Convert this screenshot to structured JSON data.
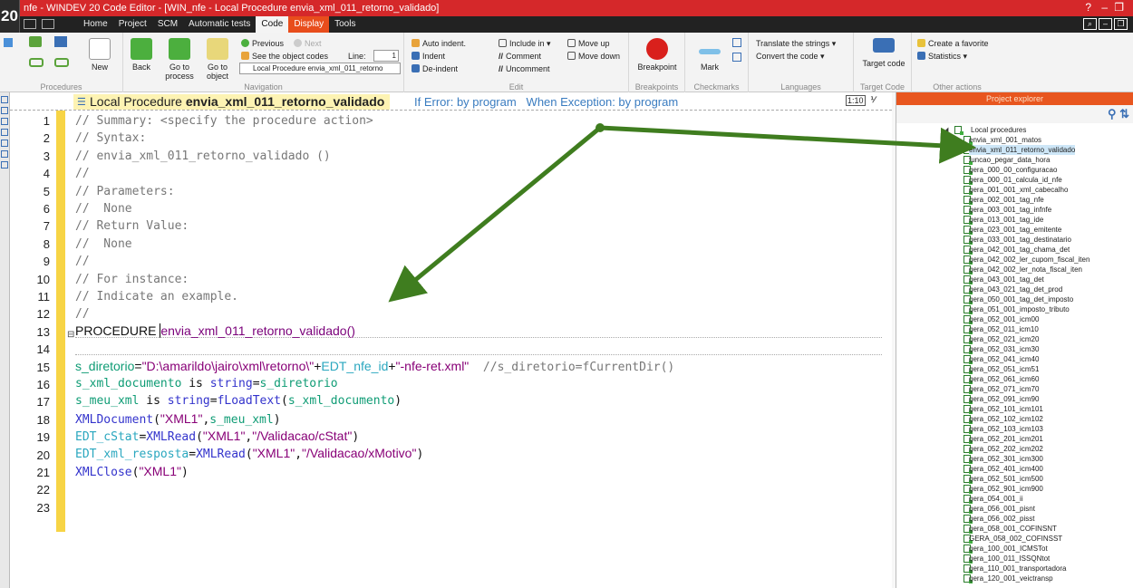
{
  "window": {
    "logo": "20",
    "title": "nfe - WINDEV 20  Code Editor - [WIN_nfe - Local Procedure envia_xml_011_retorno_validado]"
  },
  "menu": {
    "tabs": [
      "Home",
      "Project",
      "SCM",
      "Automatic tests",
      "Code",
      "Display",
      "Tools"
    ]
  },
  "ribbon": {
    "procedures": {
      "label": "Procedures",
      "new": "New"
    },
    "navigation": {
      "label": "Navigation",
      "back": "Back",
      "goto_process": "Go to process",
      "goto_object": "Go to object",
      "previous": "Previous",
      "next": "Next",
      "see_codes": "See the object codes",
      "line_label": "Line:",
      "line_value": "1",
      "combo_value": "Local Procedure envia_xml_011_retorno"
    },
    "edit": {
      "label": "Edit",
      "auto_indent": "Auto indent.",
      "indent": "Indent",
      "deindent": "De-indent",
      "include_in": "Include in",
      "comment": "Comment",
      "uncomment": "Uncomment",
      "move_up": "Move up",
      "move_down": "Move down"
    },
    "breakpoints": {
      "label": "Breakpoints",
      "breakpoint": "Breakpoint"
    },
    "checkmarks": {
      "label": "Checkmarks",
      "mark": "Mark"
    },
    "languages": {
      "label": "Languages",
      "translate": "Translate the strings",
      "convert": "Convert the code"
    },
    "target": {
      "label": "Target Code",
      "target_code": "Target code"
    },
    "other": {
      "label": "Other actions",
      "favorite": "Create a favorite",
      "statistics": "Statistics"
    }
  },
  "editor": {
    "proc_prefix": "Local Procedure ",
    "proc_name": "envia_xml_011_retorno_validado",
    "if_error": "If Error: by program",
    "when_exception": "When Exception: by program",
    "line_numbers": [
      "1",
      "2",
      "3",
      "4",
      "5",
      "6",
      "7",
      "8",
      "9",
      "10",
      "11",
      "12",
      "13",
      "14",
      "15",
      "16",
      "17",
      "18",
      "19",
      "20",
      "21",
      "22",
      "23"
    ],
    "comments": [
      "// Summary: <specify the procedure action>",
      "// Syntax:",
      "// envia_xml_011_retorno_validado ()",
      "//",
      "// Parameters:",
      "//  None",
      "// Return Value:",
      "//  None",
      "//",
      "// For instance:",
      "// Indicate an example.",
      "//"
    ],
    "l13": {
      "kw": "PROCEDURE ",
      "name": "envia_xml_011_retorno_validado()"
    },
    "l15": {
      "var": "s_diretorio",
      "eq": "=",
      "str1": "\"D:\\amarildo\\jairo\\xml\\retorno\\\"",
      "plus1": "+",
      "edt": "EDT_nfe_id",
      "plus2": "+",
      "str2": "\"-nfe-ret.xml\"",
      "cm": "  //s_diretorio=fCurrentDir()"
    },
    "l16": {
      "var": "s_xml_documento",
      "kw": " is ",
      "type": "string",
      "eq": "=",
      "var2": "s_diretorio"
    },
    "l17": {
      "var": "s_meu_xml",
      "kw": " is ",
      "type": "string",
      "eq": "=",
      "fn": "fLoadText",
      "p1": "(",
      "arg": "s_xml_documento",
      "p2": ")"
    },
    "l18": {
      "fn": "XMLDocument",
      "p1": "(",
      "str": "\"XML1\"",
      "comma": ",",
      "arg": "s_meu_xml",
      "p2": ")"
    },
    "l19": {
      "edt": "EDT_cStat",
      "eq": "=",
      "fn": "XMLRead",
      "p1": "(",
      "str1": "\"XML1\"",
      "comma": ",",
      "str2": "\"/Validacao/cStat\"",
      "p2": ")"
    },
    "l20": {
      "edt": "EDT_xml_resposta",
      "eq": "=",
      "fn": "XMLRead",
      "p1": "(",
      "str1": "\"XML1\"",
      "comma": ",",
      "str2": "\"/Validacao/xMotivo\"",
      "p2": ")"
    },
    "l21": {
      "fn": "XMLClose",
      "p1": "(",
      "str": "\"XML1\"",
      "p2": ")"
    }
  },
  "explorer": {
    "title": "Project explorer",
    "root": "Local procedures",
    "items": [
      "envia_xml_001_matos",
      "envia_xml_011_retorno_validado",
      "funcao_pegar_data_hora",
      "gera_000_00_configuracao",
      "gera_000_01_calcula_id_nfe",
      "gera_001_001_xml_cabecalho",
      "gera_002_001_tag_nfe",
      "gera_003_001_tag_infnfe",
      "gera_013_001_tag_ide",
      "gera_023_001_tag_emitente",
      "gera_033_001_tag_destinatario",
      "gera_042_001_tag_chama_det",
      "gera_042_002_ler_cupom_fiscal_iten",
      "gera_042_002_ler_nota_fiscal_iten",
      "gera_043_001_tag_det",
      "gera_043_021_tag_det_prod",
      "gera_050_001_tag_det_imposto",
      "gera_051_001_imposto_tributo",
      "gera_052_001_icm00",
      "gera_052_011_icm10",
      "gera_052_021_icm20",
      "gera_052_031_icm30",
      "gera_052_041_icm40",
      "gera_052_051_icm51",
      "gera_052_061_icm60",
      "gera_052_071_icm70",
      "gera_052_091_icm90",
      "gera_052_101_icm101",
      "gera_052_102_icm102",
      "gera_052_103_icm103",
      "gera_052_201_icm201",
      "gera_052_202_icm202",
      "gera_052_301_icm300",
      "gera_052_401_icm400",
      "gera_052_501_icm500",
      "gera_052_901_icm900",
      "gera_054_001_ii",
      "gera_056_001_pisnt",
      "gera_056_002_pisst",
      "gera_058_001_COFINSNT",
      "GERA_058_002_COFINSST",
      "gera_100_001_ICMSTot",
      "gera_100_011_ISSQNtot",
      "gera_110_001_transportadora",
      "gera_120_001_veictransp"
    ],
    "selected_index": 1
  },
  "colors": {
    "titlebar": "#d5282a",
    "display_tab": "#e84d1c",
    "explorer_title": "#e8561f",
    "annotation_arrow": "#3f7d1f",
    "yellow_margin": "#f7d445"
  }
}
